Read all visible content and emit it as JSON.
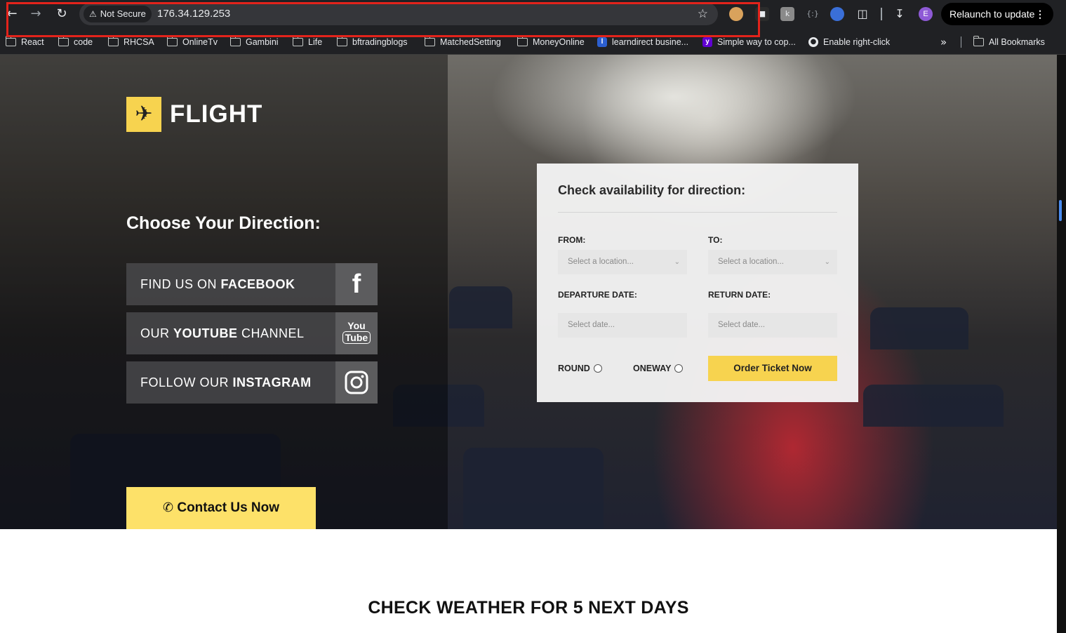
{
  "browser": {
    "security_label": "Not Secure",
    "url": "176.34.129.253",
    "relaunch_label": "Relaunch to update",
    "profile_initial": "E",
    "all_bookmarks": "All Bookmarks",
    "bookmarks": [
      {
        "label": "React",
        "icon": "folder-icon"
      },
      {
        "label": "code",
        "icon": "folder-icon"
      },
      {
        "label": "RHCSA",
        "icon": "folder-icon"
      },
      {
        "label": "OnlineTv",
        "icon": "folder-icon"
      },
      {
        "label": "Gambini",
        "icon": "folder-icon"
      },
      {
        "label": "Life",
        "icon": "folder-icon"
      },
      {
        "label": "bftradingblogs",
        "icon": "folder-icon"
      },
      {
        "label": "MatchedSetting",
        "icon": "folder-icon"
      },
      {
        "label": "MoneyOnline",
        "icon": "folder-icon"
      },
      {
        "label": "learndirect busine...",
        "icon": "learndirect-icon"
      },
      {
        "label": "Simple way to cop...",
        "icon": "yahoo-icon"
      },
      {
        "label": "Enable right-click",
        "icon": "globe-icon"
      }
    ]
  },
  "page": {
    "logo_text": "FLIGHT",
    "choose_heading": "Choose Your Direction:",
    "social": [
      {
        "prefix": "FIND US ON ",
        "bold": "FACEBOOK",
        "suffix": "",
        "icon": "facebook-icon"
      },
      {
        "prefix": "OUR ",
        "bold": "YOUTUBE",
        "suffix": " CHANNEL",
        "icon": "youtube-icon",
        "icon_top": "You",
        "icon_bottom": "Tube"
      },
      {
        "prefix": "FOLLOW OUR ",
        "bold": "INSTAGRAM",
        "suffix": "",
        "icon": "instagram-icon"
      }
    ],
    "form": {
      "title": "Check availability for direction:",
      "from_label": "FROM:",
      "to_label": "TO:",
      "from_placeholder": "Select a location...",
      "to_placeholder": "Select a location...",
      "departure_label": "DEPARTURE DATE:",
      "return_label": "RETURN DATE:",
      "departure_placeholder": "Select date...",
      "return_placeholder": "Select date...",
      "round_label": "ROUND",
      "oneway_label": "ONEWAY",
      "order_button": "Order Ticket Now"
    },
    "contact_button": "Contact Us Now",
    "weather_heading": "CHECK WEATHER FOR 5 NEXT DAYS"
  },
  "colors": {
    "accent_yellow": "#f7d34f",
    "highlight_red": "#e3231b"
  }
}
